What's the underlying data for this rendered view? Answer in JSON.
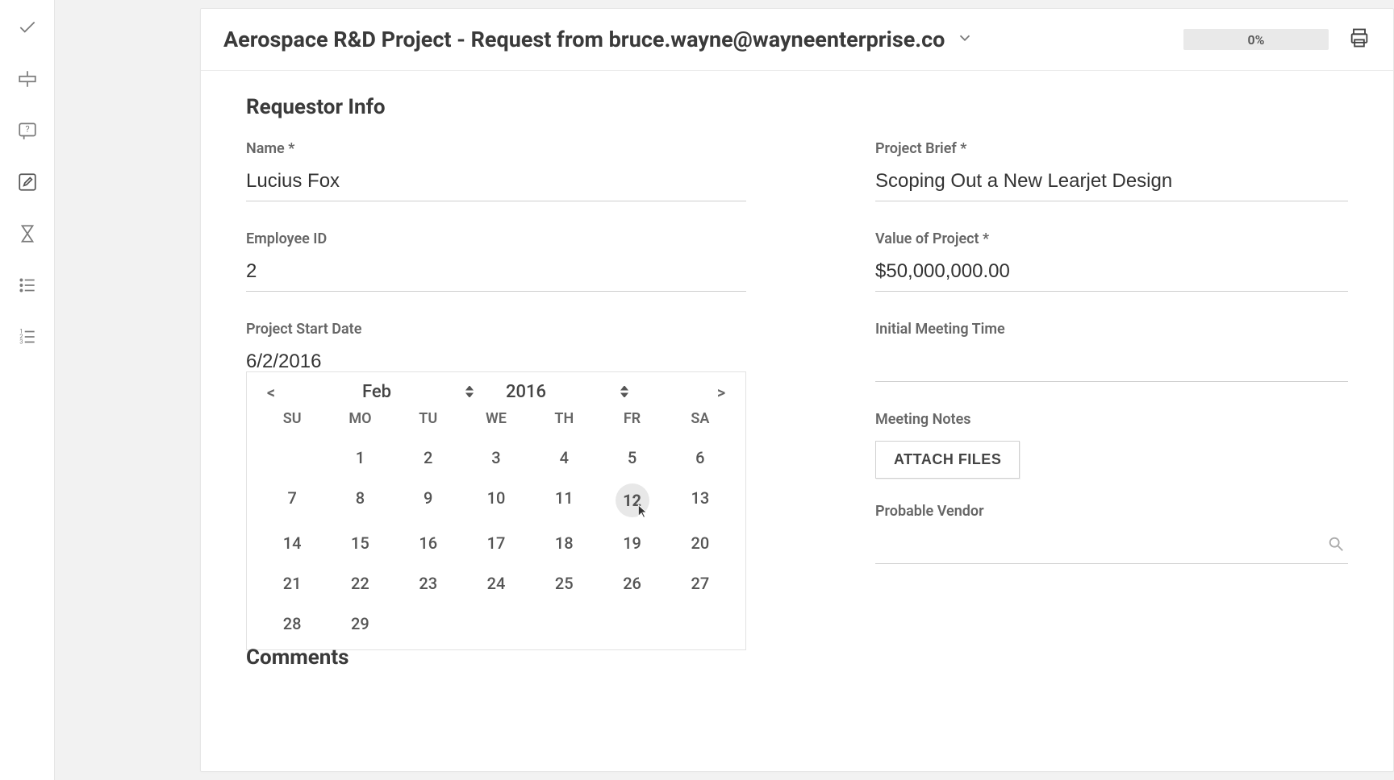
{
  "sidebar": {
    "items": [
      {
        "name": "check-icon"
      },
      {
        "name": "align-icon"
      },
      {
        "name": "help-icon"
      },
      {
        "name": "edit-icon"
      },
      {
        "name": "hourglass-icon"
      },
      {
        "name": "list-icon"
      },
      {
        "name": "numbered-list-icon"
      }
    ]
  },
  "header": {
    "title": "Aerospace R&D Project - Request from bruce.wayne@wayneenterprise.co",
    "progress_label": "0%",
    "progress_value": 0
  },
  "section": {
    "title": "Requestor Info"
  },
  "fields": {
    "name": {
      "label": "Name *",
      "value": "Lucius Fox"
    },
    "employee_id": {
      "label": "Employee ID",
      "value": "2"
    },
    "start_date": {
      "label": "Project Start Date",
      "value": "6/2/2016"
    },
    "project_brief": {
      "label": "Project Brief *",
      "value": "Scoping Out a New Learjet Design"
    },
    "project_value": {
      "label": "Value of Project *",
      "value": "$50,000,000.00"
    },
    "meeting_time": {
      "label": "Initial Meeting Time",
      "value": ""
    },
    "meeting_notes": {
      "label": "Meeting Notes",
      "attach_label": "ATTACH FILES"
    },
    "vendor": {
      "label": "Probable Vendor",
      "value": ""
    }
  },
  "calendar": {
    "prev": "<",
    "next": ">",
    "month": "Feb",
    "year": "2016",
    "dow": [
      "SU",
      "MO",
      "TU",
      "WE",
      "TH",
      "FR",
      "SA"
    ],
    "weeks": [
      [
        "",
        "1",
        "2",
        "3",
        "4",
        "5",
        "6"
      ],
      [
        "7",
        "8",
        "9",
        "10",
        "11",
        "12",
        "13"
      ],
      [
        "14",
        "15",
        "16",
        "17",
        "18",
        "19",
        "20"
      ],
      [
        "21",
        "22",
        "23",
        "24",
        "25",
        "26",
        "27"
      ],
      [
        "28",
        "29",
        "",
        "",
        "",
        "",
        ""
      ]
    ],
    "hover_day": "12"
  },
  "comments": {
    "heading": "Comments"
  }
}
